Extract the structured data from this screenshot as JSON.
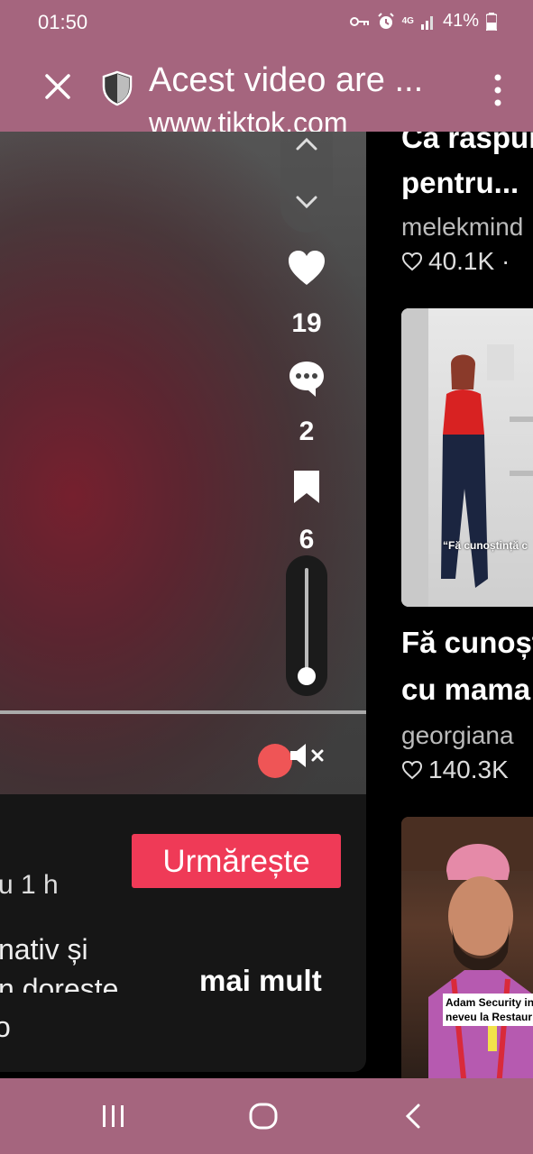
{
  "status_bar": {
    "time": "01:50",
    "battery": "41%",
    "network": "4G",
    "icons": [
      "key-icon",
      "alarm-icon",
      "signal-icon",
      "battery-icon"
    ]
  },
  "app_bar": {
    "title": "Acest video are ...",
    "url": "www.tiktok.com"
  },
  "player": {
    "likes": "19",
    "comments": "2",
    "saves": "6",
    "volume_level": 0.0
  },
  "info": {
    "follow_label": "Urmărește",
    "time_ago": "u 1 h",
    "desc_line1": "nativ și",
    "desc_line2": "n doreste",
    "desc_line3": "o",
    "more_label": "mai mult"
  },
  "related": [
    {
      "title1": "Ca raspun",
      "title2": "pentru...",
      "user": "melekmind",
      "likes": "40.1K · "
    },
    {
      "thumb_caption": "“Fă cunoștință c",
      "title1": "Fă cunoșt",
      "title2": "cu mama",
      "user": "georgiana",
      "likes": "140.3K"
    },
    {
      "thumb_caption1": "Adam Security in",
      "thumb_caption2": "neveu la Restaur"
    }
  ],
  "colors": {
    "system_bar": "#a5657e",
    "follow_button": "#ef3a57",
    "record_dot": "#ef5556"
  }
}
